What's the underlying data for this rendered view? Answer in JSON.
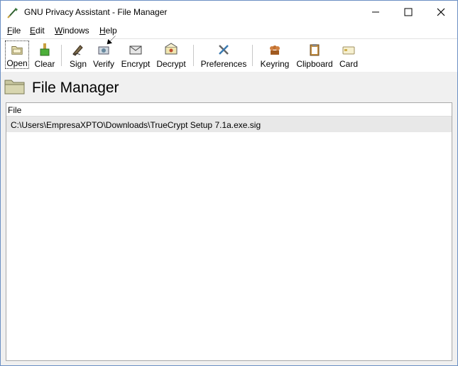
{
  "window": {
    "title": "GNU Privacy Assistant - File Manager",
    "close_glyph": "✕",
    "minimize_glyph": "—",
    "maximize_glyph": "☐"
  },
  "menu": {
    "items": [
      {
        "label": "File",
        "accel": "F"
      },
      {
        "label": "Edit",
        "accel": "E"
      },
      {
        "label": "Windows",
        "accel": "W"
      },
      {
        "label": "Help",
        "accel": "H"
      }
    ]
  },
  "toolbar": {
    "buttons": [
      {
        "label": "Open",
        "icon": "folder-open-icon"
      },
      {
        "label": "Clear",
        "icon": "broom-icon"
      },
      {
        "label": "Sign",
        "icon": "pen-sign-icon"
      },
      {
        "label": "Verify",
        "icon": "verify-icon"
      },
      {
        "label": "Encrypt",
        "icon": "envelope-encrypt-icon"
      },
      {
        "label": "Decrypt",
        "icon": "envelope-decrypt-icon"
      },
      {
        "label": "Preferences",
        "icon": "tools-icon"
      },
      {
        "label": "Keyring",
        "icon": "keyring-icon"
      },
      {
        "label": "Clipboard",
        "icon": "clipboard-icon"
      },
      {
        "label": "Card",
        "icon": "card-icon"
      }
    ]
  },
  "header": {
    "title": "File Manager"
  },
  "filelist": {
    "column": "File",
    "rows": [
      "C:\\Users\\EmpresaXPTO\\Downloads\\TrueCrypt Setup 7.1a.exe.sig"
    ]
  }
}
